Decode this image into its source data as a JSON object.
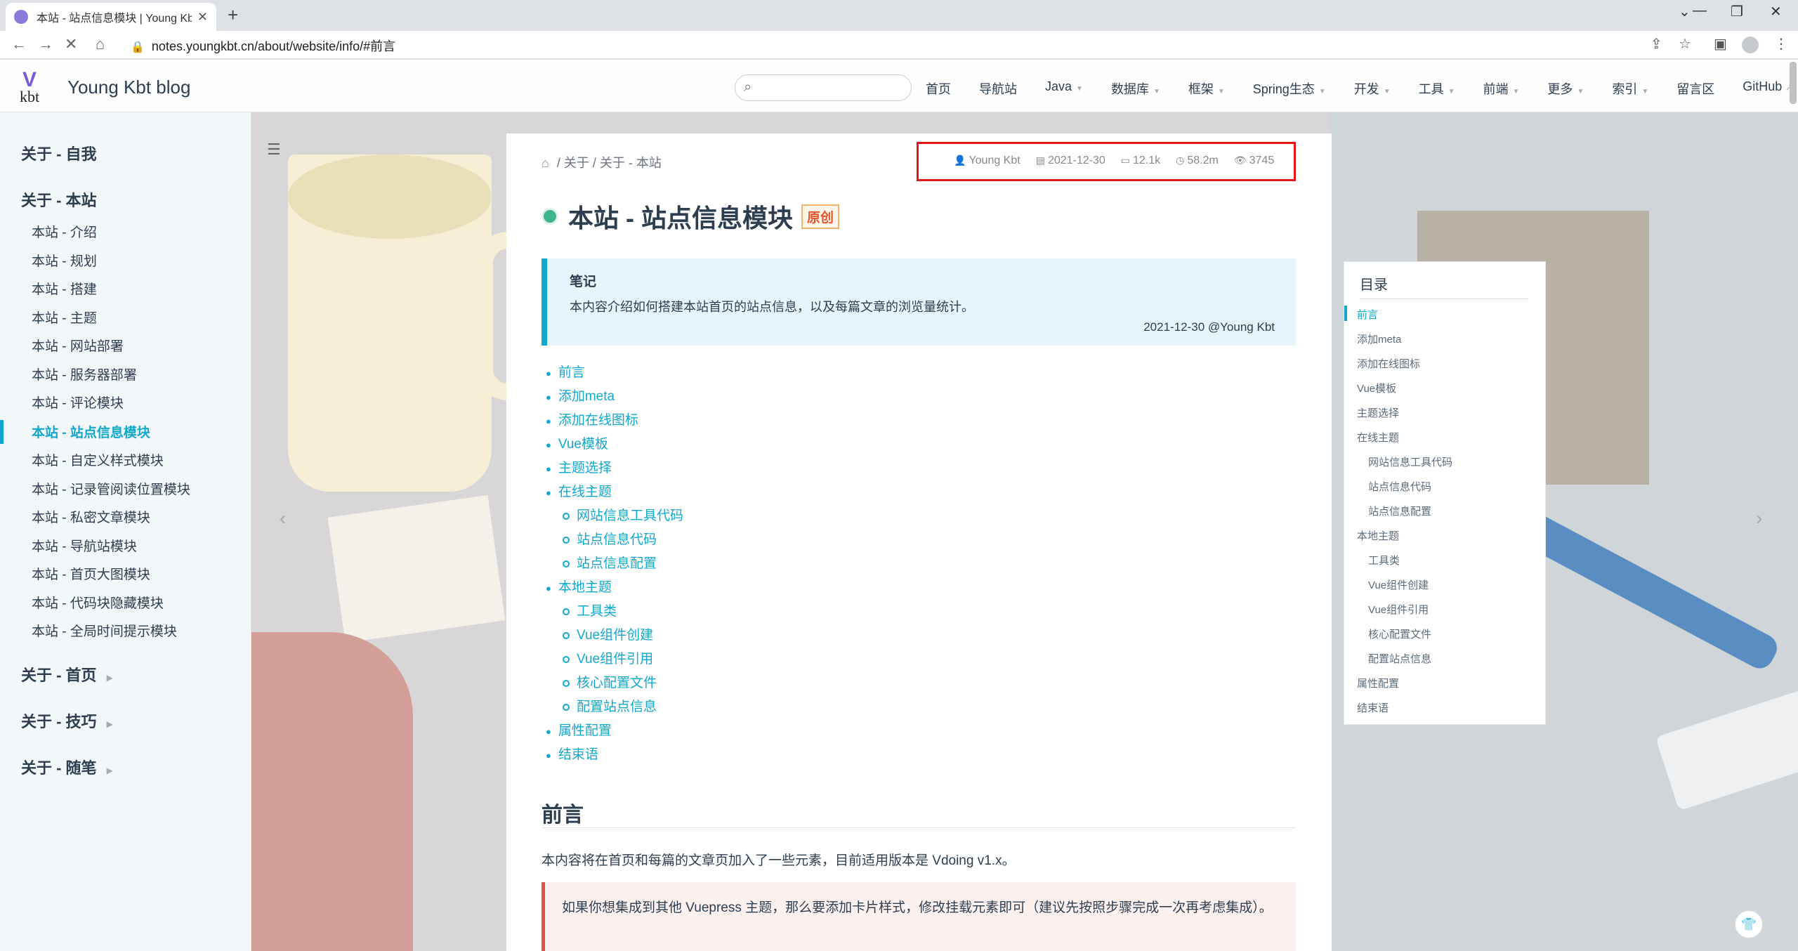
{
  "browser": {
    "tab_title": "本站 - 站点信息模块 | Young Kb",
    "tab_close": "✕",
    "new_tab": "+",
    "url": "notes.youngkbt.cn/about/website/info/#前言",
    "controls": {
      "minimize": "—",
      "restore": "❐",
      "close": "✕",
      "chevron": "⌄"
    }
  },
  "site": {
    "name": "Young Kbt blog",
    "logo_text": "kbt",
    "logo_mark": "V",
    "search_placeholder": "",
    "nav": [
      {
        "label": "首页",
        "caret": false
      },
      {
        "label": "导航站",
        "caret": false
      },
      {
        "label": "Java",
        "caret": true
      },
      {
        "label": "数据库",
        "caret": true
      },
      {
        "label": "框架",
        "caret": true
      },
      {
        "label": "Spring生态",
        "caret": true
      },
      {
        "label": "开发",
        "caret": true
      },
      {
        "label": "工具",
        "caret": true
      },
      {
        "label": "前端",
        "caret": true
      },
      {
        "label": "更多",
        "caret": true
      },
      {
        "label": "索引",
        "caret": true
      },
      {
        "label": "留言区",
        "caret": false
      },
      {
        "label": "GitHub",
        "caret": false,
        "external": true
      }
    ]
  },
  "sidebar": {
    "groups": [
      {
        "label": "关于 - 自我"
      },
      {
        "label": "关于 - 本站"
      },
      {
        "label": "关于 - 首页"
      },
      {
        "label": "关于 - 技巧"
      },
      {
        "label": "关于 - 随笔"
      }
    ],
    "items": [
      "本站 - 介绍",
      "本站 - 规划",
      "本站 - 搭建",
      "本站 - 主题",
      "本站 - 网站部署",
      "本站 - 服务器部署",
      "本站 - 评论模块",
      "本站 - 站点信息模块",
      "本站 - 自定义样式模块",
      "本站 - 记录管阅读位置模块",
      "本站 - 私密文章模块",
      "本站 - 导航站模块",
      "本站 - 首页大图模块",
      "本站 - 代码块隐藏模块",
      "本站 - 全局时间提示模块"
    ],
    "active_index": 7
  },
  "article": {
    "breadcrumb": [
      "关于",
      "关于 - 本站"
    ],
    "meta": {
      "author": "Young Kbt",
      "date": "2021-12-30",
      "words": "12.1k",
      "reading_time": "58.2m",
      "views": "3745"
    },
    "title": "本站 - 站点信息模块",
    "badge": "原创",
    "note": {
      "title": "笔记",
      "body": "本内容介绍如何搭建本站首页的站点信息，以及每篇文章的浏览量统计。",
      "sign": "2021-12-30 @Young Kbt"
    },
    "toc": [
      {
        "label": "前言",
        "level": 1
      },
      {
        "label": "添加meta",
        "level": 1
      },
      {
        "label": "添加在线图标",
        "level": 1
      },
      {
        "label": "Vue模板",
        "level": 1
      },
      {
        "label": "主题选择",
        "level": 1
      },
      {
        "label": "在线主题",
        "level": 1
      },
      {
        "label": "网站信息工具代码",
        "level": 2
      },
      {
        "label": "站点信息代码",
        "level": 2
      },
      {
        "label": "站点信息配置",
        "level": 2
      },
      {
        "label": "本地主题",
        "level": 1
      },
      {
        "label": "工具类",
        "level": 2
      },
      {
        "label": "Vue组件创建",
        "level": 2
      },
      {
        "label": "Vue组件引用",
        "level": 2
      },
      {
        "label": "核心配置文件",
        "level": 2
      },
      {
        "label": "配置站点信息",
        "level": 2
      },
      {
        "label": "属性配置",
        "level": 1
      },
      {
        "label": "结束语",
        "level": 1
      }
    ],
    "section_heading": "前言",
    "intro": "本内容将在首页和每篇的文章页加入了一些元素，目前适用版本是 Vdoing v1.x。",
    "warning": "如果你想集成到其他 Vuepress 主题，那么要添加卡片样式，修改挂载元素即可（建议先按照步骤完成一次再考虑集成）。"
  },
  "toc_panel": {
    "title": "目录",
    "active_index": 0
  }
}
